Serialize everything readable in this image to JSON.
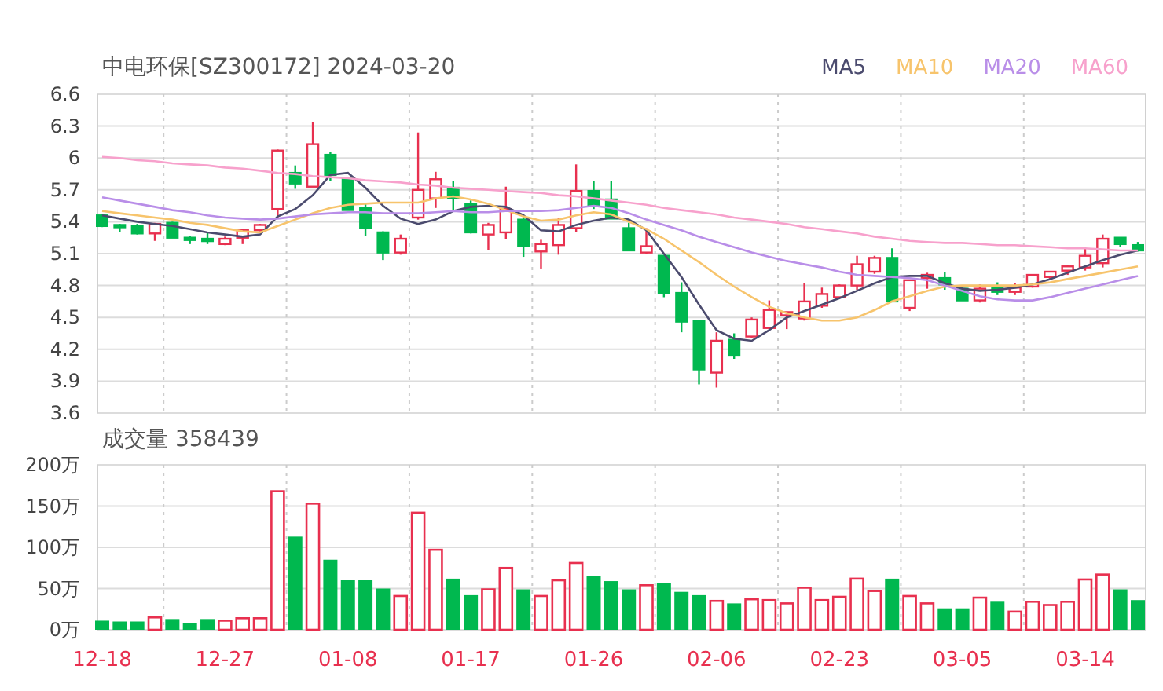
{
  "price_chart": {
    "chart_data": {
      "type": "candlestick",
      "title": "中电环保[SZ300172] 2024-03-20",
      "grid": true,
      "ylim": [
        3.6,
        6.6
      ],
      "categories": [
        null,
        null,
        null,
        null,
        null,
        null,
        null,
        null,
        null,
        null,
        null,
        null,
        null,
        null,
        null,
        null,
        null,
        null,
        null,
        null,
        null,
        null,
        null,
        null,
        null,
        null,
        null,
        null,
        null,
        null,
        null,
        null,
        null,
        null,
        null,
        null,
        null,
        null,
        null,
        null,
        null,
        null,
        null,
        null,
        null,
        null,
        null,
        null,
        null,
        null,
        null,
        null,
        null,
        null,
        null,
        null,
        null,
        null,
        null,
        null
      ],
      "yticks": [
        {
          "value": 6.6,
          "label": "6.6"
        },
        {
          "value": 6.3,
          "label": "6.3"
        },
        {
          "value": 6.0,
          "label": "6"
        },
        {
          "value": 5.7,
          "label": "5.7"
        },
        {
          "value": 5.4,
          "label": "5.4"
        },
        {
          "value": 5.1,
          "label": "5.1"
        },
        {
          "value": 4.8,
          "label": "4.8"
        },
        {
          "value": 4.5,
          "label": "4.5"
        },
        {
          "value": 4.2,
          "label": "4.2"
        },
        {
          "value": 3.9,
          "label": "3.9"
        },
        {
          "value": 3.6,
          "label": "3.6"
        }
      ],
      "ohlc": [
        [
          5.46,
          5.47,
          5.35,
          5.36
        ],
        [
          5.37,
          5.38,
          5.3,
          5.36
        ],
        [
          5.36,
          5.38,
          5.28,
          5.29
        ],
        [
          5.29,
          5.39,
          5.22,
          5.38
        ],
        [
          5.39,
          5.4,
          5.25,
          5.25
        ],
        [
          5.25,
          5.27,
          5.19,
          5.23
        ],
        [
          5.24,
          5.3,
          5.19,
          5.23
        ],
        [
          5.19,
          5.26,
          5.18,
          5.24
        ],
        [
          5.25,
          5.33,
          5.19,
          5.32
        ],
        [
          5.32,
          5.38,
          5.31,
          5.37
        ],
        [
          5.52,
          6.08,
          5.44,
          6.07
        ],
        [
          5.86,
          5.93,
          5.71,
          5.76
        ],
        [
          5.73,
          6.34,
          5.73,
          6.13
        ],
        [
          6.03,
          6.06,
          5.78,
          5.84
        ],
        [
          5.81,
          5.82,
          5.51,
          5.51
        ],
        [
          5.53,
          5.57,
          5.27,
          5.34
        ],
        [
          5.3,
          5.31,
          5.04,
          5.11
        ],
        [
          5.11,
          5.28,
          5.09,
          5.24
        ],
        [
          5.44,
          6.24,
          5.42,
          5.7
        ],
        [
          5.62,
          5.87,
          5.53,
          5.8
        ],
        [
          5.72,
          5.78,
          5.51,
          5.62
        ],
        [
          5.57,
          5.6,
          5.29,
          5.3
        ],
        [
          5.28,
          5.39,
          5.13,
          5.37
        ],
        [
          5.3,
          5.73,
          5.24,
          5.52
        ],
        [
          5.42,
          5.45,
          5.07,
          5.17
        ],
        [
          5.12,
          5.23,
          4.96,
          5.19
        ],
        [
          5.18,
          5.44,
          5.09,
          5.37
        ],
        [
          5.34,
          5.94,
          5.3,
          5.69
        ],
        [
          5.69,
          5.78,
          5.52,
          5.55
        ],
        [
          5.61,
          5.78,
          5.43,
          5.43
        ],
        [
          5.34,
          5.39,
          5.13,
          5.13
        ],
        [
          5.11,
          5.34,
          5.1,
          5.17
        ],
        [
          5.08,
          5.08,
          4.69,
          4.73
        ],
        [
          4.73,
          4.83,
          4.36,
          4.46
        ],
        [
          4.47,
          4.47,
          3.87,
          4.01
        ],
        [
          3.98,
          4.36,
          3.84,
          4.28
        ],
        [
          4.29,
          4.35,
          4.11,
          4.14
        ],
        [
          4.32,
          4.5,
          4.31,
          4.48
        ],
        [
          4.4,
          4.66,
          4.4,
          4.57
        ],
        [
          4.52,
          4.55,
          4.39,
          4.55
        ],
        [
          4.49,
          4.82,
          4.47,
          4.65
        ],
        [
          4.61,
          4.78,
          4.59,
          4.72
        ],
        [
          4.69,
          4.81,
          4.68,
          4.8
        ],
        [
          4.8,
          5.08,
          4.76,
          5.0
        ],
        [
          4.93,
          5.08,
          4.91,
          5.06
        ],
        [
          5.06,
          5.15,
          4.65,
          4.65
        ],
        [
          4.59,
          4.85,
          4.56,
          4.85
        ],
        [
          4.87,
          4.92,
          4.77,
          4.9
        ],
        [
          4.87,
          4.93,
          4.76,
          4.81
        ],
        [
          4.77,
          4.79,
          4.66,
          4.66
        ],
        [
          4.66,
          4.81,
          4.64,
          4.77
        ],
        [
          4.79,
          4.83,
          4.71,
          4.74
        ],
        [
          4.74,
          4.82,
          4.71,
          4.78
        ],
        [
          4.79,
          4.9,
          4.78,
          4.9
        ],
        [
          4.88,
          4.93,
          4.86,
          4.93
        ],
        [
          4.94,
          4.99,
          4.9,
          4.98
        ],
        [
          4.97,
          5.16,
          4.94,
          5.08
        ],
        [
          5.01,
          5.28,
          4.97,
          5.24
        ],
        [
          5.25,
          5.25,
          5.16,
          5.19
        ],
        [
          5.18,
          5.21,
          5.12,
          5.13
        ]
      ],
      "series": [
        {
          "name": "MA5",
          "type": "line",
          "color": "#4b4b6e",
          "values": [
            5.46,
            5.43,
            5.4,
            5.38,
            5.36,
            5.33,
            5.3,
            5.28,
            5.26,
            5.28,
            5.45,
            5.52,
            5.65,
            5.84,
            5.86,
            5.72,
            5.55,
            5.43,
            5.38,
            5.42,
            5.5,
            5.54,
            5.55,
            5.54,
            5.46,
            5.32,
            5.31,
            5.37,
            5.41,
            5.44,
            5.42,
            5.32,
            5.1,
            4.88,
            4.62,
            4.38,
            4.3,
            4.28,
            4.38,
            4.5,
            4.56,
            4.62,
            4.68,
            4.75,
            4.82,
            4.88,
            4.89,
            4.89,
            4.82,
            4.77,
            4.75,
            4.76,
            4.78,
            4.81,
            4.86,
            4.92,
            4.98,
            5.04,
            5.09,
            5.13
          ]
        },
        {
          "name": "MA10",
          "type": "line",
          "color": "#f7c46c",
          "values": [
            5.5,
            5.48,
            5.46,
            5.44,
            5.42,
            5.39,
            5.37,
            5.34,
            5.31,
            5.3,
            5.36,
            5.42,
            5.48,
            5.53,
            5.56,
            5.57,
            5.58,
            5.58,
            5.58,
            5.62,
            5.64,
            5.61,
            5.57,
            5.51,
            5.45,
            5.41,
            5.42,
            5.46,
            5.49,
            5.47,
            5.4,
            5.33,
            5.24,
            5.13,
            5.02,
            4.9,
            4.79,
            4.69,
            4.6,
            4.54,
            4.5,
            4.47,
            4.47,
            4.5,
            4.57,
            4.65,
            4.7,
            4.75,
            4.79,
            4.8,
            4.8,
            4.8,
            4.8,
            4.81,
            4.83,
            4.86,
            4.89,
            4.92,
            4.95,
            4.98
          ]
        },
        {
          "name": "MA20",
          "type": "line",
          "color": "#b98ee8",
          "values": [
            5.63,
            5.6,
            5.57,
            5.54,
            5.51,
            5.49,
            5.46,
            5.44,
            5.43,
            5.42,
            5.43,
            5.45,
            5.47,
            5.48,
            5.49,
            5.49,
            5.48,
            5.48,
            5.48,
            5.49,
            5.5,
            5.49,
            5.49,
            5.5,
            5.5,
            5.5,
            5.51,
            5.53,
            5.55,
            5.53,
            5.48,
            5.42,
            5.37,
            5.32,
            5.26,
            5.21,
            5.16,
            5.11,
            5.07,
            5.03,
            5.0,
            4.97,
            4.93,
            4.9,
            4.89,
            4.88,
            4.87,
            4.85,
            4.8,
            4.75,
            4.7,
            4.67,
            4.66,
            4.66,
            4.69,
            4.73,
            4.77,
            4.81,
            4.85,
            4.89
          ]
        },
        {
          "name": "MA60",
          "type": "line",
          "color": "#f7a1cc",
          "values": [
            6.01,
            6.0,
            5.98,
            5.97,
            5.95,
            5.94,
            5.93,
            5.91,
            5.9,
            5.88,
            5.86,
            5.85,
            5.83,
            5.82,
            5.81,
            5.79,
            5.78,
            5.77,
            5.75,
            5.74,
            5.72,
            5.71,
            5.7,
            5.69,
            5.68,
            5.67,
            5.65,
            5.64,
            5.62,
            5.6,
            5.58,
            5.56,
            5.53,
            5.51,
            5.49,
            5.47,
            5.44,
            5.42,
            5.4,
            5.38,
            5.35,
            5.33,
            5.31,
            5.29,
            5.26,
            5.24,
            5.22,
            5.21,
            5.2,
            5.2,
            5.19,
            5.18,
            5.18,
            5.17,
            5.16,
            5.15,
            5.15,
            5.14,
            5.13,
            5.13
          ]
        }
      ]
    }
  },
  "volume_chart": {
    "chart_data": {
      "type": "bar",
      "title": "成交量 358439",
      "grid": true,
      "ylim": [
        0,
        200
      ],
      "categories": [
        "12-18",
        null,
        null,
        null,
        null,
        null,
        null,
        "12-27",
        null,
        null,
        null,
        null,
        null,
        null,
        "01-08",
        null,
        null,
        null,
        null,
        null,
        null,
        "01-17",
        null,
        null,
        null,
        null,
        null,
        null,
        "01-26",
        null,
        null,
        null,
        null,
        null,
        null,
        "02-06",
        null,
        null,
        null,
        null,
        null,
        null,
        "02-23",
        null,
        null,
        null,
        null,
        null,
        null,
        "03-05",
        null,
        null,
        null,
        null,
        null,
        null,
        "03-14",
        null,
        null,
        null
      ],
      "yticks": [
        {
          "value": 200,
          "label": "200万"
        },
        {
          "value": 150,
          "label": "150万"
        },
        {
          "value": 100,
          "label": "100万"
        },
        {
          "value": 50,
          "label": "50万"
        },
        {
          "value": 0,
          "label": "0万"
        }
      ],
      "values": [
        11,
        10,
        10,
        15,
        13,
        8,
        13,
        11,
        14,
        14,
        168,
        113,
        153,
        85,
        60,
        60,
        50,
        41,
        142,
        97,
        62,
        42,
        49,
        75,
        49,
        41,
        60,
        81,
        65,
        59,
        49,
        54,
        57,
        46,
        42,
        35,
        32,
        37,
        36,
        32,
        51,
        36,
        40,
        62,
        47,
        62,
        41,
        32,
        26,
        26,
        39,
        34,
        22,
        34,
        30,
        34,
        61,
        67,
        49,
        36
      ]
    }
  }
}
